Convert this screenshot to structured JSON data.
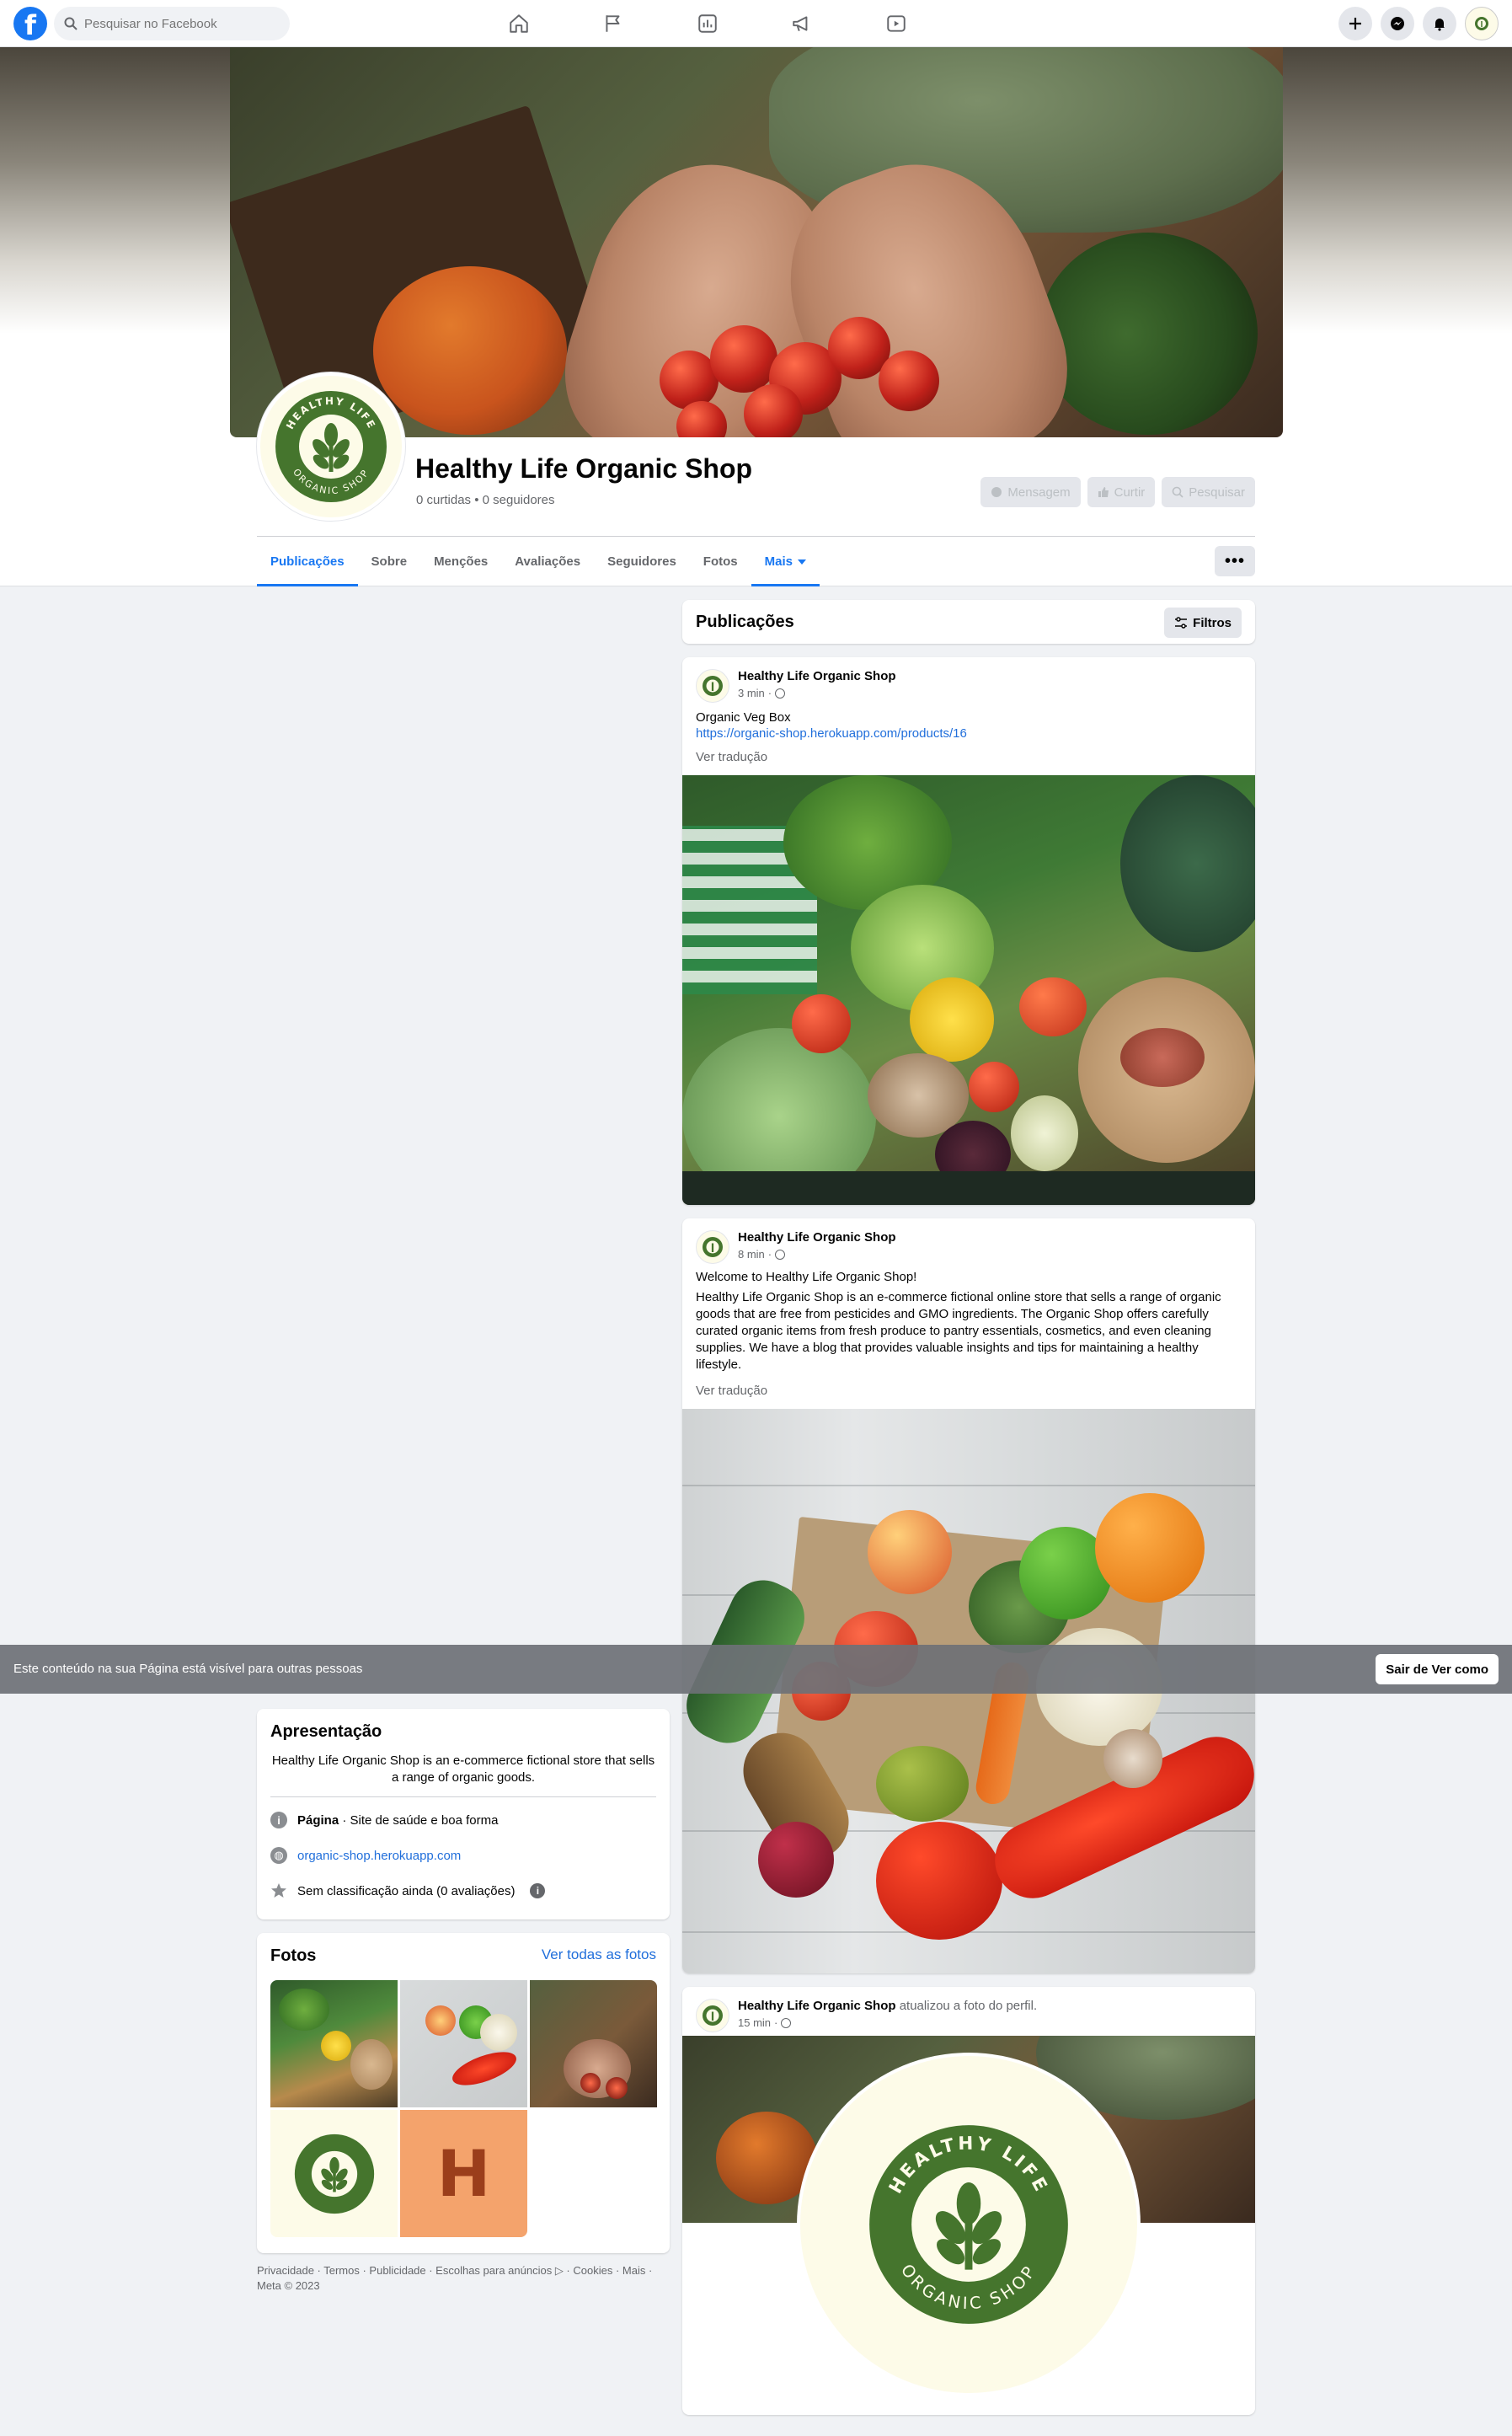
{
  "nav": {
    "search_placeholder": "Pesquisar no Facebook",
    "logo_letter": "f"
  },
  "page": {
    "name": "Healthy Life Organic Shop",
    "stats": "0 curtidas • 0 seguidores",
    "buttons": {
      "message": "Mensagem",
      "like": "Curtir",
      "search": "Pesquisar"
    },
    "more_dots": "•••"
  },
  "tabs": [
    {
      "label": "Publicações"
    },
    {
      "label": "Sobre"
    },
    {
      "label": "Menções"
    },
    {
      "label": "Avaliações"
    },
    {
      "label": "Seguidores"
    },
    {
      "label": "Fotos"
    },
    {
      "label": "Mais"
    }
  ],
  "feed": {
    "header": "Publicações",
    "filters": "Filtros",
    "posts": [
      {
        "author": "Healthy Life Organic Shop",
        "time": "3 min",
        "text": "Organic Veg Box",
        "link": "https://organic-shop.herokuapp.com/products/16",
        "translate": "Ver tradução"
      },
      {
        "author": "Healthy Life Organic Shop",
        "time": "8 min",
        "title": "Welcome to Healthy Life Organic Shop!",
        "text": "Healthy Life Organic Shop is an e-commerce fictional online store that sells a range of organic goods that are free from pesticides and GMO ingredients. The Organic Shop offers carefully curated organic items from fresh produce to pantry essentials, cosmetics, and even cleaning supplies. We have a blog that provides valuable insights and tips for maintaining a healthy lifestyle.",
        "translate": "Ver tradução"
      },
      {
        "author": "Healthy Life Organic Shop",
        "action": "atualizou a foto do perfil.",
        "time": "15 min"
      }
    ]
  },
  "banner": {
    "text": "Este conteúdo na sua Página está visível para outras pessoas",
    "button": "Sair de Ver como"
  },
  "intro": {
    "title": "Apresentação",
    "bio": "Healthy Life Organic Shop is an e-commerce fictional store that sells a range of organic goods.",
    "category_label": "Página",
    "category_value": " · Site de saúde e boa forma",
    "website": "organic-shop.herokuapp.com",
    "rating": "Sem classificação ainda (0 avaliações)"
  },
  "photos": {
    "title": "Fotos",
    "see_all": "Ver todas as fotos",
    "letter_tile": "H"
  },
  "logo": {
    "top_text": "HEALTHY LIFE",
    "bottom_text": "ORGANIC SHOP",
    "ring_color": "#45752d",
    "cream": "#fdfbe8"
  },
  "footer": {
    "line1": "Privacidade · Termos · Publicidade · Escolhas para anúncios ▷ · Cookies · Mais ·",
    "line2": "Meta © 2023"
  },
  "colors": {
    "accent": "#1877f2",
    "link": "#216fdb",
    "background": "#f0f2f5"
  }
}
